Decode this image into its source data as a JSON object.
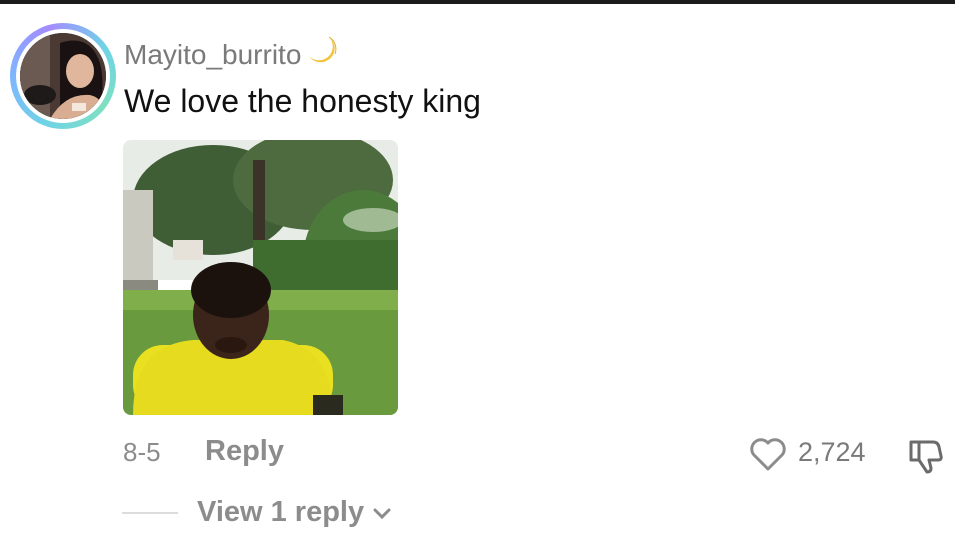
{
  "comment": {
    "username": "Mayito_burrito",
    "username_emoji": "🌙",
    "text": "We love the honesty king",
    "date": "8-5",
    "reply_label": "Reply",
    "like_count": "2,724",
    "view_replies_label": "View 1 reply"
  },
  "icons": {
    "avatar_ring": "avatar-gradient-ring",
    "moon": "moon-emoji-icon",
    "like": "heart-outline-icon",
    "dislike": "thumbs-down-outline-icon",
    "expand": "chevron-down-icon"
  },
  "colors": {
    "text_primary": "#111111",
    "text_muted": "#8c8c8c",
    "username": "#7a7a7a",
    "divider": "#dcdcdc"
  }
}
